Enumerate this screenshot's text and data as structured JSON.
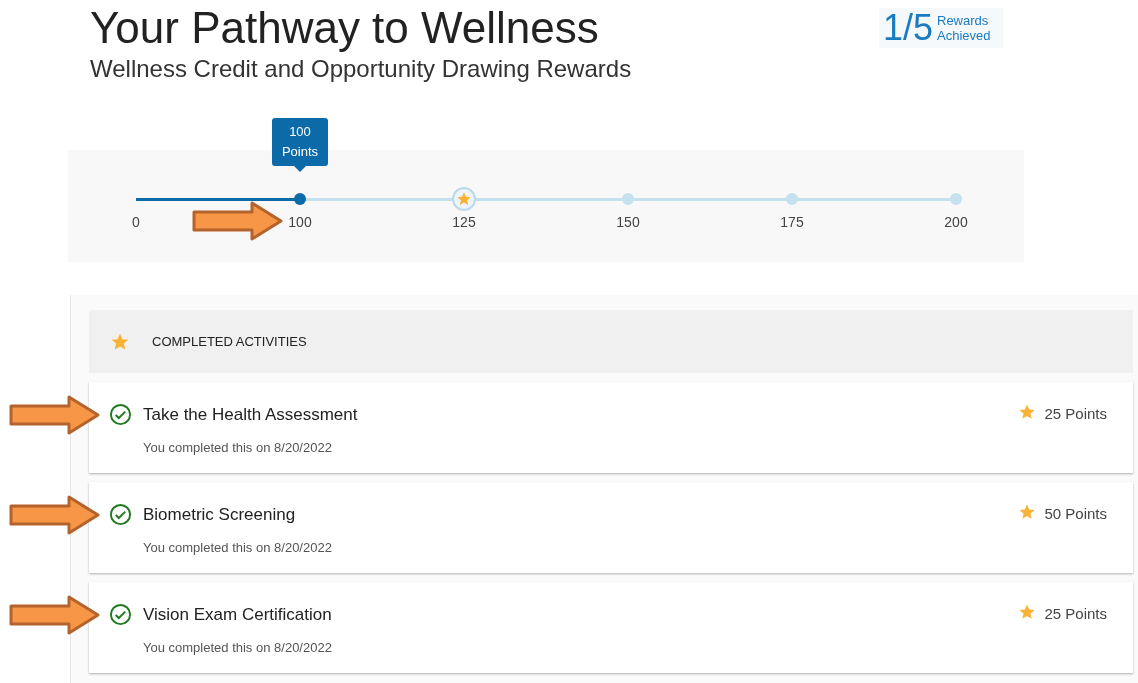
{
  "header": {
    "title": "Your Pathway to Wellness",
    "subtitle": "Wellness Credit and Opportunity Drawing Rewards",
    "rewards_count": "1/5",
    "rewards_label": "Rewards Achieved"
  },
  "progress": {
    "level": 0.2,
    "tooltip": "100 Points",
    "milestones": [
      {
        "label": "0",
        "kind": "start",
        "annotated": false
      },
      {
        "label": "100",
        "kind": "current",
        "annotated": true
      },
      {
        "label": "125",
        "kind": "reward",
        "annotated": false
      },
      {
        "label": "150",
        "kind": "point",
        "annotated": false
      },
      {
        "label": "175",
        "kind": "point",
        "annotated": false
      },
      {
        "label": "200",
        "kind": "point",
        "annotated": false
      }
    ]
  },
  "completed": {
    "heading": "COMPLETED ACTIVITIES",
    "activities": [
      {
        "title": "Take the Health Assessment",
        "note": "You completed this on 8/20/2022",
        "points": "25 Points",
        "annotated": true
      },
      {
        "title": "Biometric Screening",
        "note": "You completed this on 8/20/2022",
        "points": "50 Points",
        "annotated": true
      },
      {
        "title": "Vision Exam Certification",
        "note": "You completed this on 8/20/2022",
        "points": "25 Points",
        "annotated": true
      }
    ]
  }
}
